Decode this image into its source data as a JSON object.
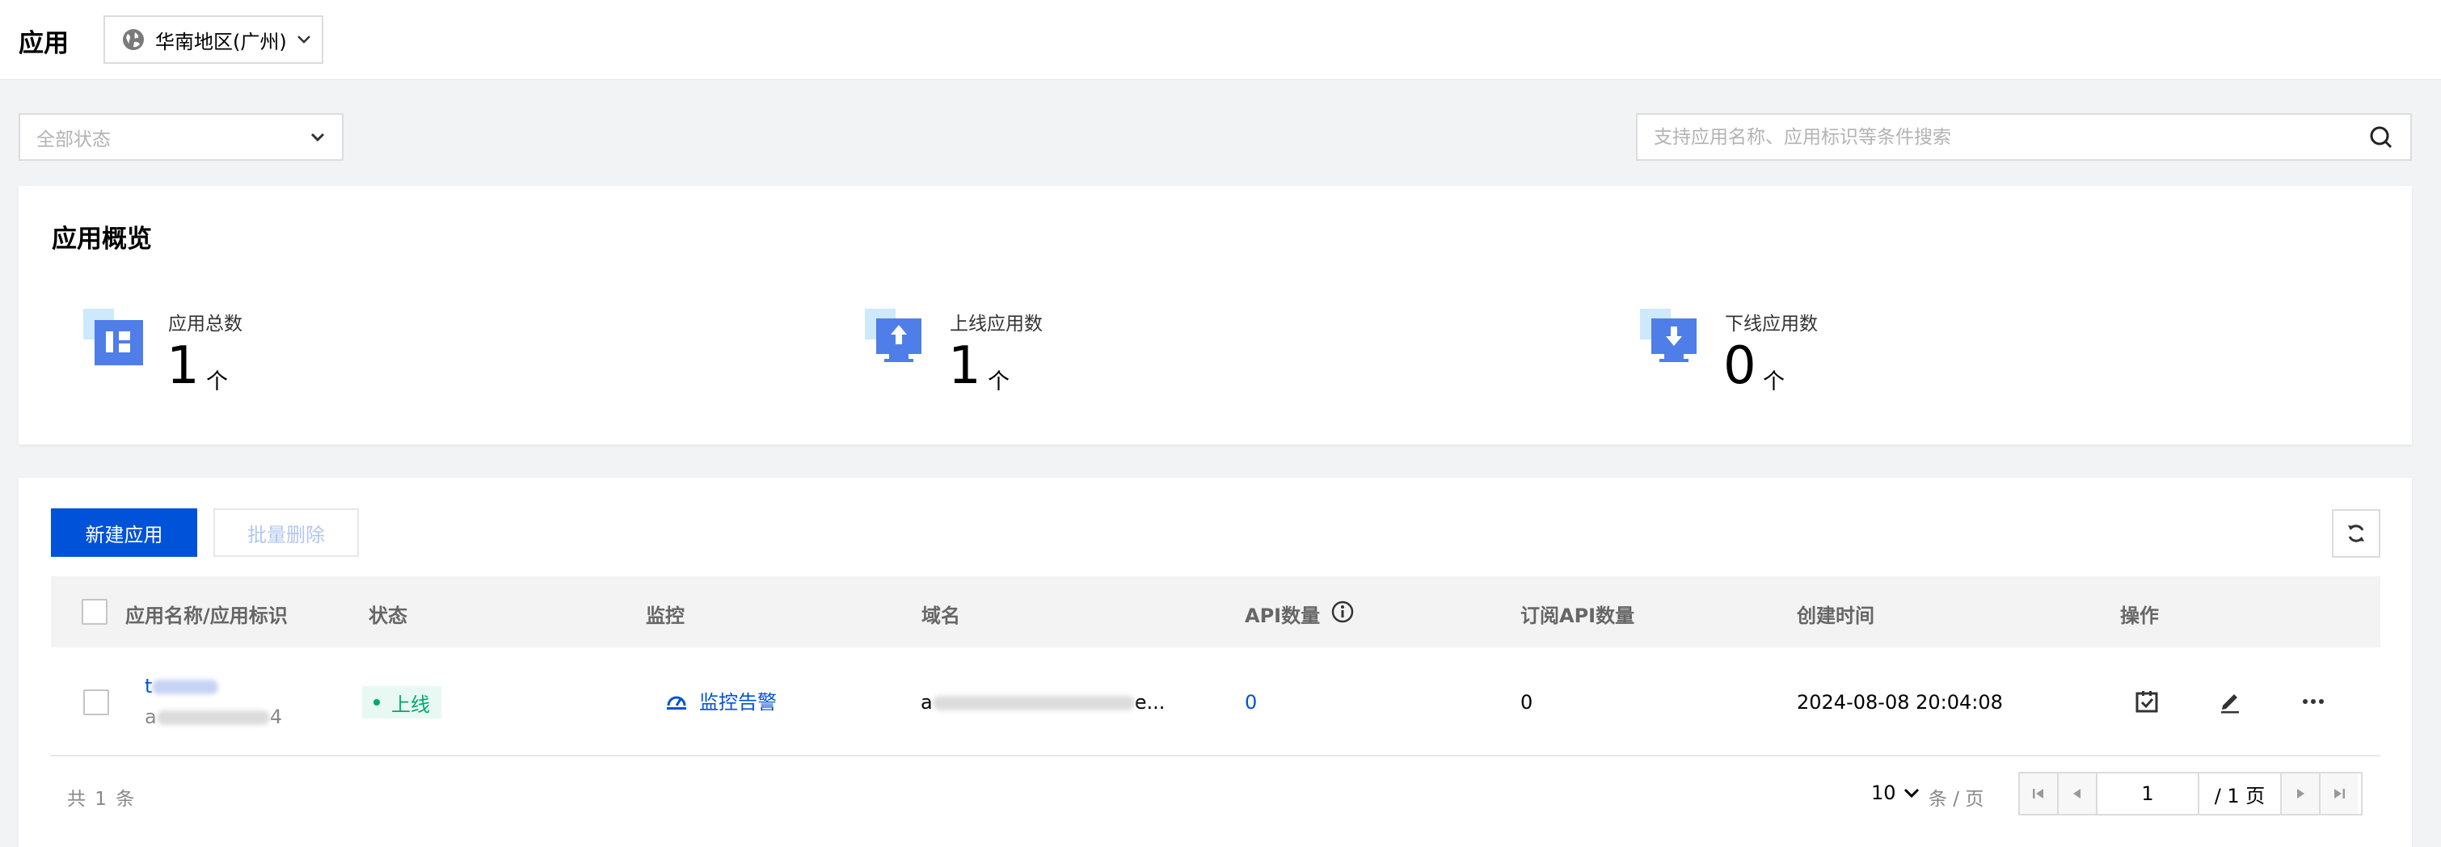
{
  "header": {
    "title": "应用",
    "region": "华南地区(广州)"
  },
  "filters": {
    "status_placeholder": "全部状态",
    "search_placeholder": "支持应用名称、应用标识等条件搜索"
  },
  "overview": {
    "title": "应用概览",
    "stats": [
      {
        "label": "应用总数",
        "value": "1",
        "unit": "个",
        "icon": "apps-grid-icon"
      },
      {
        "label": "上线应用数",
        "value": "1",
        "unit": "个",
        "icon": "monitor-upload-icon"
      },
      {
        "label": "下线应用数",
        "value": "0",
        "unit": "个",
        "icon": "monitor-download-icon"
      }
    ]
  },
  "toolbar": {
    "new_label": "新建应用",
    "batch_delete_label": "批量删除"
  },
  "table": {
    "columns": [
      "应用名称/应用标识",
      "状态",
      "监控",
      "域名",
      "API数量",
      "订阅API数量",
      "创建时间",
      "操作"
    ],
    "rows": [
      {
        "name_prefix": "t",
        "id_prefix": "a",
        "id_suffix": "4",
        "status": "上线",
        "monitor": "监控告警",
        "domain_prefix": "a",
        "domain_suffix": "e...",
        "api_count": "0",
        "sub_api_count": "0",
        "created": "2024-08-08 20:04:08"
      }
    ]
  },
  "pagination": {
    "total_text": "共 1 条",
    "page_size": "10",
    "page_size_suffix": "条 / 页",
    "current_page": "1",
    "total_pages": "/ 1 页"
  },
  "colors": {
    "primary": "#0052d9",
    "success": "#00a870",
    "background": "#f2f3f5"
  }
}
